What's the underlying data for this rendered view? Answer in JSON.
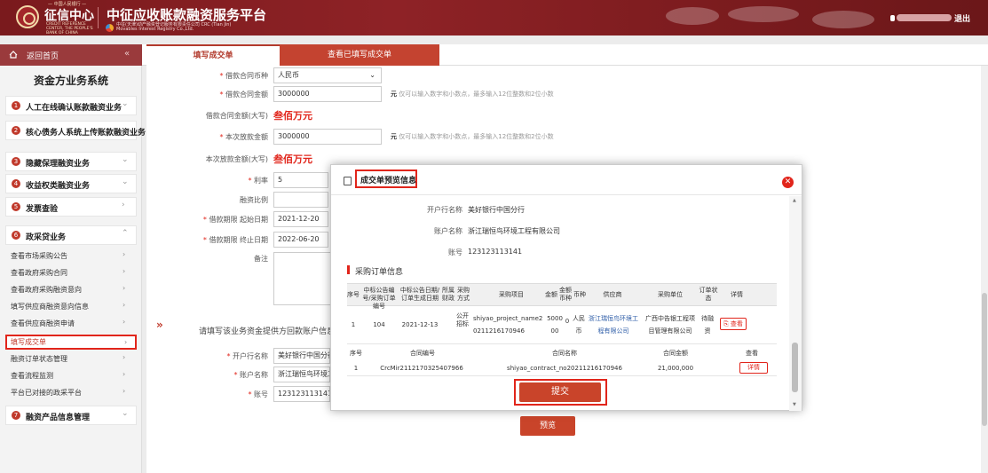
{
  "header": {
    "org_top": "— 中国人民银行 —",
    "org_name": "征信中心",
    "org_en": "CREDIT REFERENCE CENTER, THE PEOPLE'S BANK OF CHINA",
    "platform_title": "中征应收账款融资服务平台",
    "platform_sub": "中征(天津)动产融资登记服务有限责任公司 CRC (Tian Jin) Movables Interest Registry Co.,Ltd.",
    "logout": "退出"
  },
  "nav": {
    "home": "返回首页",
    "collapse": "«",
    "tabs": [
      {
        "label": "填写成交单"
      },
      {
        "label": "查看已填写成交单"
      }
    ]
  },
  "sidebar": {
    "title": "资金方业务系统",
    "sections": [
      {
        "num": "1",
        "label": "人工在线确认账款融资业务"
      },
      {
        "num": "2",
        "label": "核心债务人系统上传账款融资业务"
      },
      {
        "num": "3",
        "label": "隐藏保理融资业务"
      },
      {
        "num": "4",
        "label": "收益权类融资业务"
      },
      {
        "num": "5",
        "label": "发票查验"
      },
      {
        "num": "6",
        "label": "政采贷业务"
      },
      {
        "num": "7",
        "label": "融资产品信息管理"
      }
    ],
    "sub_items": [
      {
        "label": "查看市场采购公告"
      },
      {
        "label": "查看政府采购合同"
      },
      {
        "label": "查看政府采购融资意向"
      },
      {
        "label": "填写供应商融资意向信息"
      },
      {
        "label": "查看供应商融资申请"
      },
      {
        "label": "填写成交单"
      },
      {
        "label": "融资订单状态管理"
      },
      {
        "label": "查看流程监测"
      },
      {
        "label": "平台已对接的政采平台"
      }
    ],
    "arrow": "›",
    "arrow_down": "⌄",
    "arrow_up": "⌃"
  },
  "form": {
    "currency_label": "借款合同币种",
    "currency_value": "人民币",
    "contract_amount_label": "借款合同金额",
    "contract_amount_value": "3000000",
    "amount_hint_unit": "元",
    "amount_hint": "仅可以输入数字和小数点，最多输入12位整数和2位小数",
    "contract_amount_upper_label": "借款合同金额(大写)",
    "contract_amount_upper_value": "叁佰万元",
    "loan_amount_label": "本次放款金额",
    "loan_amount_value": "3000000",
    "loan_amount_upper_label": "本次放款金额(大写)",
    "loan_amount_upper_value": "叁佰万元",
    "rate_label": "利率",
    "rate_value": "5",
    "ratio_label": "融资比例",
    "start_label": "借款期限 起始日期",
    "start_value": "2021-12-20",
    "end_label": "借款期限 终止日期",
    "end_value": "2022-06-20",
    "remark_label": "备注",
    "prompt": "请填写该业务资金提供方回款账户信息",
    "bank_label": "开户行名称",
    "bank_value": "美好银行中国分行",
    "acct_name_label": "账户名称",
    "acct_name_value": "浙江瑞恒鸟环境工",
    "acct_no_label": "账号",
    "acct_no_value": "123123113141",
    "preview_btn": "预览",
    "req_mark": "*"
  },
  "modal": {
    "title": "成交单预览信息",
    "close": "✕",
    "bank_label": "开户行名称",
    "bank_value": "美好银行中国分行",
    "acct_name_label": "账户名称",
    "acct_name_value": "浙江瑞恒鸟环境工程有限公司",
    "acct_no_label": "账号",
    "acct_no_value": "123123113141",
    "po_section": "采购订单信息",
    "po_headers": [
      "序号",
      "中标公告编号/采购订单编号",
      "中标公告日期/订单生成日期",
      "所属财政",
      "采购方式",
      "采购项目",
      "金额",
      "金额币种",
      "币种",
      "供应商",
      "采购单位",
      "订单状态",
      "详情"
    ],
    "po_row": {
      "no": "1",
      "code": "104",
      "date": "2021-12-13",
      "method": "公开招标",
      "project": "shiyao_project_name20211216170946",
      "amount": "500000",
      "amount_ccy": "0",
      "ccy": "人民币",
      "supplier": "浙江瑞恒鸟环境工程有限公司",
      "buyer": "广西中告银工程项目管理有限公司",
      "status": "待融资",
      "view": "查看"
    },
    "ct_headers": [
      "序号",
      "合同编号",
      "合同名称",
      "合同金额",
      "查看"
    ],
    "ct_row": {
      "no": "1",
      "code": "CrcMir2112170325407966",
      "name": "shiyao_contract_no20211216170946",
      "amount": "21,000,000",
      "detail": "详情"
    },
    "submit": "提交"
  }
}
